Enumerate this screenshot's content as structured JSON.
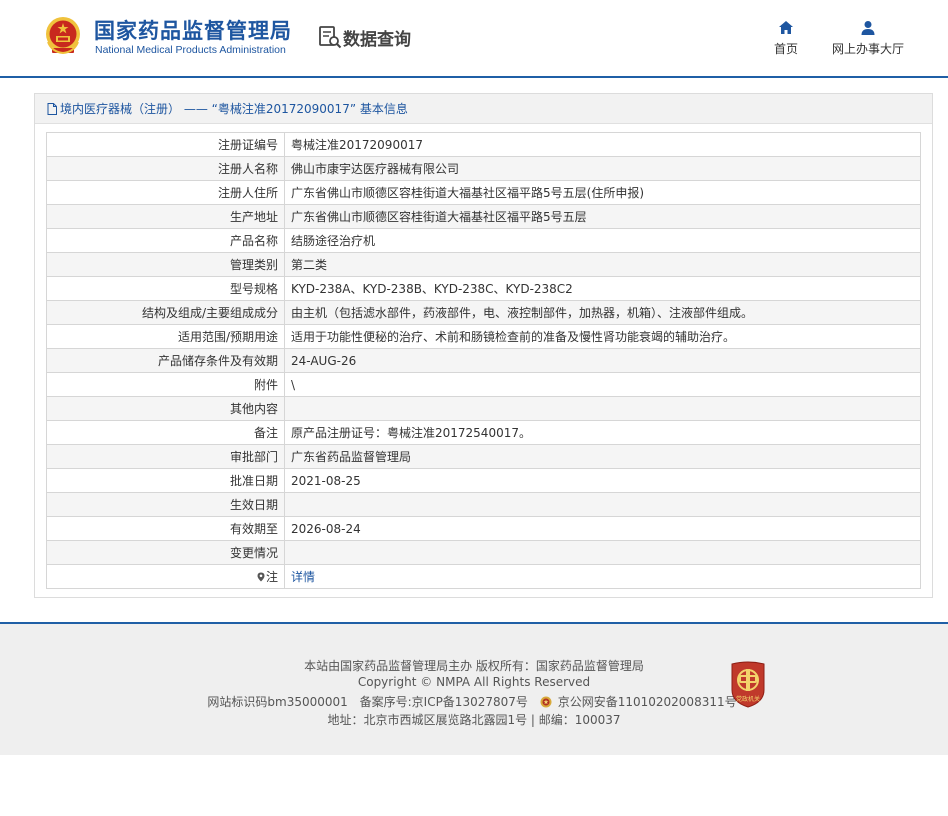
{
  "header": {
    "logo_cn": "国家药品监督管理局",
    "logo_en": "National Medical Products Administration",
    "section_title": "数据查询",
    "nav": {
      "home": "首页",
      "service_hall": "网上办事大厅"
    }
  },
  "panel": {
    "title": "境内医疗器械（注册） —— “粤械注准20172090017” 基本信息",
    "rows": [
      {
        "label": "注册证编号",
        "value": "粤械注准20172090017"
      },
      {
        "label": "注册人名称",
        "value": "佛山市康宇达医疗器械有限公司"
      },
      {
        "label": "注册人住所",
        "value": "广东省佛山市顺德区容桂街道大福基社区福平路5号五层(住所申报)"
      },
      {
        "label": "生产地址",
        "value": "广东省佛山市顺德区容桂街道大福基社区福平路5号五层"
      },
      {
        "label": "产品名称",
        "value": "结肠途径治疗机"
      },
      {
        "label": "管理类别",
        "value": "第二类"
      },
      {
        "label": "型号规格",
        "value": "KYD-238A、KYD-238B、KYD-238C、KYD-238C2"
      },
      {
        "label": "结构及组成/主要组成成分",
        "value": "由主机（包括滤水部件，药液部件，电、液控制部件，加热器，机箱）、注液部件组成。"
      },
      {
        "label": "适用范围/预期用途",
        "value": "适用于功能性便秘的治疗、术前和肠镜检查前的准备及慢性肾功能衰竭的辅助治疗。"
      },
      {
        "label": "产品储存条件及有效期",
        "value": "24-AUG-26"
      },
      {
        "label": "附件",
        "value": "\\"
      },
      {
        "label": "其他内容",
        "value": ""
      },
      {
        "label": "备注",
        "value": "原产品注册证号：粤械注准20172540017。"
      },
      {
        "label": "审批部门",
        "value": "广东省药品监督管理局"
      },
      {
        "label": "批准日期",
        "value": "2021-08-25"
      },
      {
        "label": "生效日期",
        "value": ""
      },
      {
        "label": "有效期至",
        "value": "2026-08-24"
      },
      {
        "label": "变更情况",
        "value": ""
      }
    ],
    "note_label": "注",
    "note_link": "详情"
  },
  "footer": {
    "line1": "本站由国家药品监督管理局主办 版权所有：国家药品监督管理局",
    "line2": "Copyright © NMPA All Rights Reserved",
    "site_id": "网站标识码bm35000001",
    "icp": "备案序号:京ICP备13027807号",
    "police": "京公网安备11010202008311号",
    "address": "地址：北京市西城区展览路北露园1号 | 邮编：100037",
    "badge_text": "党政机关"
  },
  "colors": {
    "brand_blue": "#1e56a0",
    "header_rule": "#1f5fa6",
    "row_alt": "#f5f5f5",
    "footer_bg": "#efefef",
    "emblem_red": "#c8281e",
    "emblem_gold": "#f0c23c"
  }
}
